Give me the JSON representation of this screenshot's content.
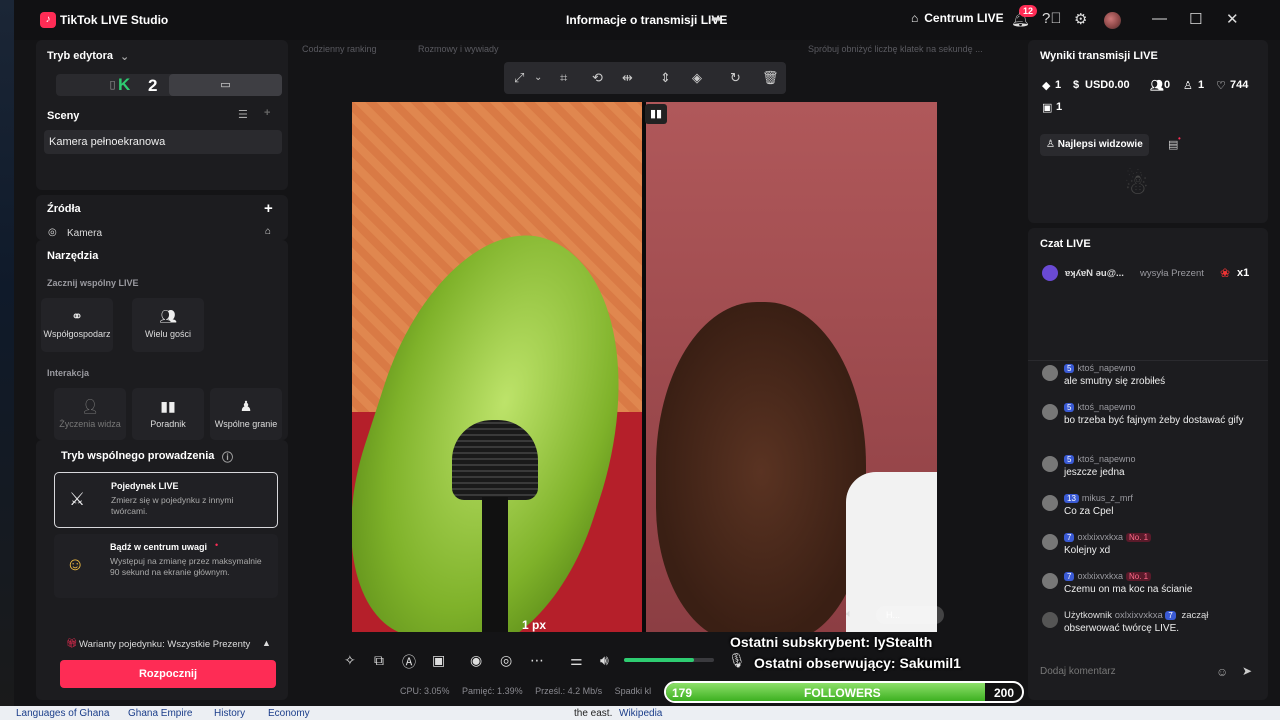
{
  "app": {
    "title": "TikTok LIVE Studio",
    "logo_letter": "♪"
  },
  "header": {
    "live_info": "Informacje o transmisji LIVE",
    "centrum_live": "Centrum LIVE",
    "notifications_count": "12"
  },
  "editor": {
    "mode_label": "Tryb edytora",
    "mode_badge": "2",
    "scenes_title": "Sceny",
    "scene_item": "Kamera pełnoekranowa",
    "sources_title": "Źródła",
    "source_item": "Kamera",
    "tools_title": "Narzędzia",
    "shared_live_title": "Zacznij wspólny LIVE",
    "tool_cohost": "Współgospodarz",
    "tool_guests": "Wielu gości",
    "interaction_title": "Interakcja",
    "tool_wishes": "Życzenia widza",
    "tool_guide": "Poradnik",
    "tool_shared": "Wspólne granie",
    "collab_mode_title": "Tryb wspólnego prowadzenia",
    "duel_title": "Pojedynek LIVE",
    "duel_desc": "Zmierz się w pojedynku z innymi twórcami.",
    "spotlight_title": "Bądź w centrum uwagi",
    "spotlight_desc": "Występuj na zmianę przez maksymalnie 90 sekund na ekranie głównym.",
    "variants_label": "Warianty pojedynku: Wszystkie Prezenty",
    "start_button": "Rozpocznij"
  },
  "hints": {
    "h1": "Codzienny ranking",
    "h2": "Rozmowy i wywiady",
    "h3": "Spróbuj obniżyć liczbę klatek na sekundę ..."
  },
  "preview": {
    "px_label": "1 px",
    "mini_badge": "H..."
  },
  "status": {
    "cpu": "CPU: 3.05%",
    "memory": "Pamięć: 1.39%",
    "bitrate": "Prześl.: 4.2 Mb/s",
    "drops": "Spadki kl"
  },
  "overlay": {
    "last_sub": "Ostatni subskrybent: lyStealth",
    "last_follower": "Ostatni obserwujący: Sakumil1",
    "followers_label": "FOLLOWERS",
    "followers_current": "179",
    "followers_goal": "200",
    "followers_progress": 0.895
  },
  "volume": {
    "level": 0.78
  },
  "results": {
    "title": "Wyniki transmisji LIVE",
    "diamonds": "1",
    "usd": "USD0.00",
    "viewers": "0",
    "new_followers": "1",
    "likes": "744",
    "gifts": "1",
    "top_viewers_button": "Najlepsi widzowie"
  },
  "chat": {
    "title": "Czat LIVE",
    "gift_user": "ɐʞʎɐN ǝu@...",
    "gift_text": "wysyła Prezent",
    "gift_count": "x1",
    "messages": [
      {
        "level": "5",
        "name": "ktoś_napewno",
        "text": "ale smutny się zrobiłeś"
      },
      {
        "level": "5",
        "name": "ktoś_napewno",
        "text": "bo trzeba być fajnym żeby dostawać gify"
      },
      {
        "level": "5",
        "name": "ktoś_napewno",
        "text": "jeszcze jedna"
      },
      {
        "level": "13",
        "name": "mikus_z_mrf",
        "text": "Co za Cpel"
      },
      {
        "level": "7",
        "name": "oxlxixvxkxa",
        "text": "Kolejny xd",
        "badge": "No. 1"
      },
      {
        "level": "7",
        "name": "oxlxixvxkxa",
        "text": "Czemu on ma koc na ścianie",
        "badge": "No. 1"
      }
    ],
    "follow_user_prefix": "Użytkownik",
    "follow_user": "oxlxixvxkxa",
    "follow_level": "7",
    "follow_text": "zaczął obserwować twórcę LIVE.",
    "comment_placeholder": "Dodaj komentarz"
  },
  "browser_bottom": {
    "link1": "Languages of Ghana",
    "link2": "Ghana Empire",
    "link3": "History",
    "link4": "Economy",
    "text": "the east.",
    "wiki": "Wikipedia"
  },
  "colors": {
    "accent": "#fe2c55",
    "progress": "#3db021",
    "level_badge": "#3a5ad4"
  }
}
